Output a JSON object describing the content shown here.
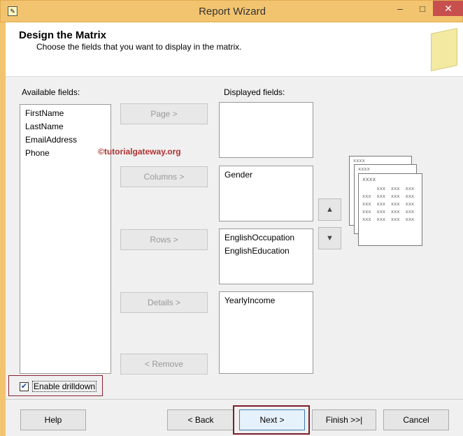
{
  "window": {
    "title": "Report Wizard",
    "minimize": "–",
    "maximize": "□",
    "close": "✕"
  },
  "header": {
    "title": "Design the Matrix",
    "subtitle": "Choose the fields that you want to display in the matrix."
  },
  "available": {
    "label": "Available fields:",
    "items": [
      "FirstName",
      "LastName",
      "EmailAddress",
      "Phone"
    ]
  },
  "displayed": {
    "label": "Displayed fields:",
    "page": [],
    "columns": [
      "Gender"
    ],
    "rows": [
      "EnglishOccupation",
      "EnglishEducation"
    ],
    "details": [
      "YearlyIncome"
    ]
  },
  "move_buttons": {
    "page": "Page >",
    "columns": "Columns >",
    "rows": "Rows >",
    "details": "Details >",
    "remove": "< Remove"
  },
  "watermark": "©tutorialgateway.org",
  "drilldown": {
    "label": "Enable drilldown",
    "checked": true
  },
  "preview": {
    "header": "xxxx",
    "cell": "xxx"
  },
  "footer": {
    "help": "Help",
    "back": "< Back",
    "next": "Next >",
    "finish": "Finish >>|",
    "cancel": "Cancel"
  }
}
